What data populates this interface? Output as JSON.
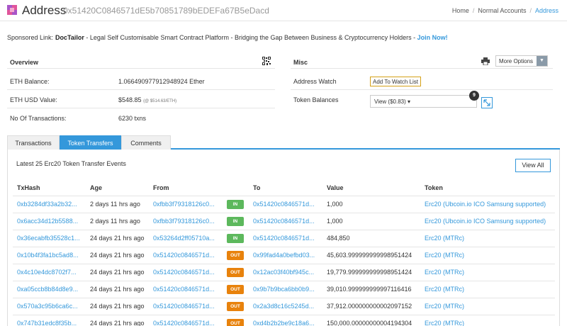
{
  "header": {
    "title": "Address",
    "address": "0x51420C0846571dE5b70851789bEDEFa67B5eDacd",
    "breadcrumb": [
      "Home",
      "Normal Accounts",
      "Address"
    ]
  },
  "sponsor": {
    "label": "Sponsored Link:",
    "brand": "DocTailor",
    "text": " - Legal Self Customisable Smart Contract Platform - Bridging the Gap Between Business & Cryptocurrency Holders - ",
    "join": "Join Now!"
  },
  "overview": {
    "title": "Overview",
    "balance_label": "ETH Balance:",
    "balance_value": "1.066490977912948924 Ether",
    "usd_label": "ETH USD Value:",
    "usd_value": "$548.85",
    "usd_rate": "(@ $514.63/ETH)",
    "txns_label": "No Of Transactions:",
    "txns_value": "6230 txns"
  },
  "misc": {
    "title": "Misc",
    "more_options": "More Options",
    "watch_label": "Address Watch",
    "watch_button": "Add To Watch List",
    "token_label": "Token Balances",
    "token_select": "View ($0.83)",
    "token_count": "9"
  },
  "tabs": [
    "Transactions",
    "Token Transfers",
    "Comments"
  ],
  "transfers": {
    "latest": "Latest 25 Erc20 Token Transfer Events",
    "view_all": "View All",
    "headers": [
      "TxHash",
      "Age",
      "From",
      "",
      "To",
      "Value",
      "Token"
    ],
    "rows": [
      {
        "hash": "0xb3284df33a2b32...",
        "age": "2 days 11 hrs ago",
        "from": "0xfbb3f79318126c0...",
        "dir": "IN",
        "to": "0x51420c0846571d...",
        "value": "1,000",
        "token": "Erc20 (Ubcoin.io ICO Samsung supported)"
      },
      {
        "hash": "0x6acc34d12b5588...",
        "age": "2 days 11 hrs ago",
        "from": "0xfbb3f79318126c0...",
        "dir": "IN",
        "to": "0x51420c0846571d...",
        "value": "1,000",
        "token": "Erc20 (Ubcoin.io ICO Samsung supported)"
      },
      {
        "hash": "0x36ecabfb35528c1...",
        "age": "24 days 21 hrs ago",
        "from": "0x53264d2ff05710a...",
        "dir": "IN",
        "to": "0x51420c0846571d...",
        "value": "484,850",
        "token": "Erc20 (MTRc)"
      },
      {
        "hash": "0x10b4f3fa1bc5ad8...",
        "age": "24 days 21 hrs ago",
        "from": "0x51420c0846571d...",
        "dir": "OUT",
        "to": "0x99fad4a0befbd03...",
        "value": "45,603.999999999998951424",
        "token": "Erc20 (MTRc)"
      },
      {
        "hash": "0x4c10e4dc8702f7...",
        "age": "24 days 21 hrs ago",
        "from": "0x51420c0846571d...",
        "dir": "OUT",
        "to": "0x12ac03f40bf945c...",
        "value": "19,779.999999999998951424",
        "token": "Erc20 (MTRc)"
      },
      {
        "hash": "0xa05ccb8b84d8e9...",
        "age": "24 days 21 hrs ago",
        "from": "0x51420c0846571d...",
        "dir": "OUT",
        "to": "0x9b7b9bca6bb0b9...",
        "value": "39,010.999999999997116416",
        "token": "Erc20 (MTRc)"
      },
      {
        "hash": "0x570a3c95b6ca6c...",
        "age": "24 days 21 hrs ago",
        "from": "0x51420c0846571d...",
        "dir": "OUT",
        "to": "0x2a3d8c16c5245d...",
        "value": "37,912.000000000002097152",
        "token": "Erc20 (MTRc)"
      },
      {
        "hash": "0x747b31edc8f35b...",
        "age": "24 days 21 hrs ago",
        "from": "0x51420c0846571d...",
        "dir": "OUT",
        "to": "0xd4b2b2be9c18a6...",
        "value": "150,000.00000000004194304",
        "token": "Erc20 (MTRc)"
      }
    ]
  }
}
